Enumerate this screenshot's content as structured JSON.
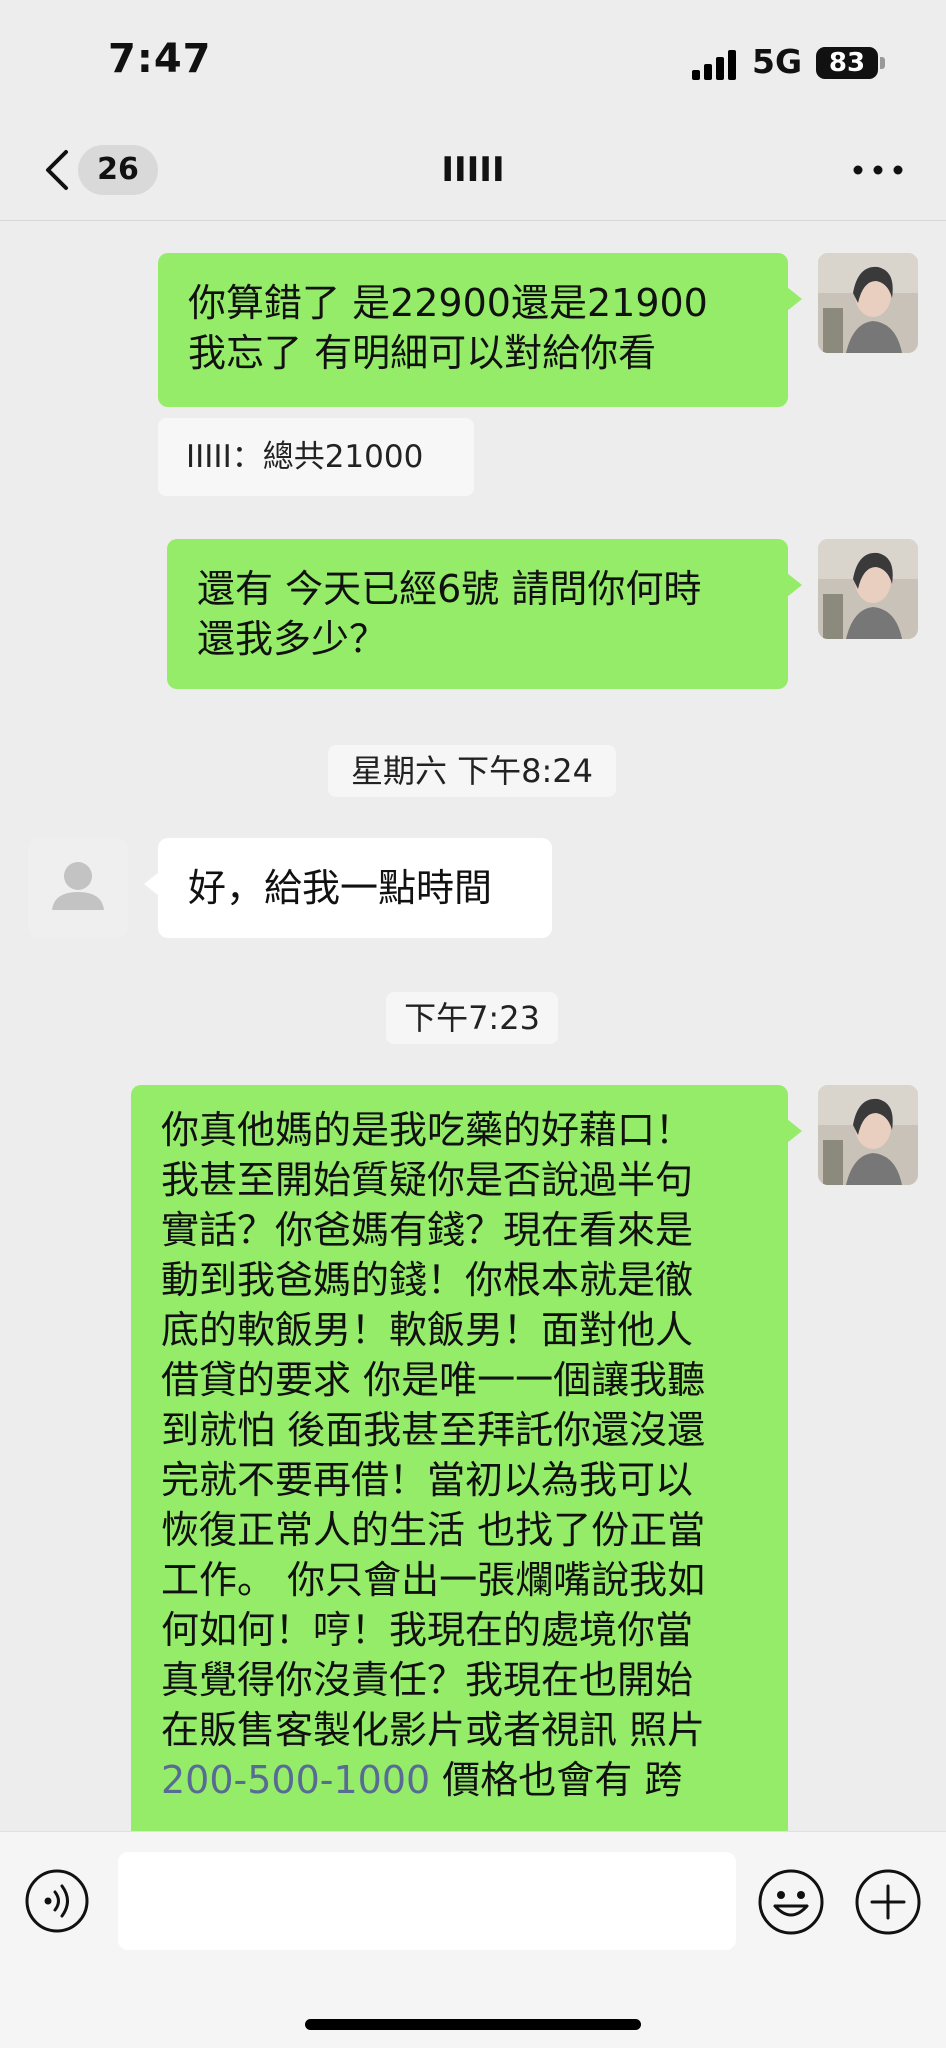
{
  "status_bar": {
    "time": "7:47",
    "network": "5G",
    "battery": "83"
  },
  "nav": {
    "unread_count": "26",
    "title": "IIIII"
  },
  "messages": {
    "m1": {
      "text": "你算錯了 是22900還是21900\n我忘了 有明細可以對給你看"
    },
    "quote": {
      "text": "IIIII：總共21000"
    },
    "m2": {
      "text": "還有 今天已經6號 請問你何時\n還我多少？"
    },
    "time1": {
      "text": "星期六 下午8:24"
    },
    "m3": {
      "text": "好，給我一點時間"
    },
    "time2": {
      "text": "下午7:23"
    },
    "m4": {
      "text_before": "你真他媽的是我吃藥的好藉口！\n我甚至開始質疑你是否說過半句\n實話？你爸媽有錢？現在看來是\n動到我爸媽的錢！你根本就是徹\n底的軟飯男！軟飯男！面對他人\n借貸的要求 你是唯一一個讓我聽\n到就怕 後面我甚至拜託你還沒還\n完就不要再借！當初以為我可以\n恢復正常人的生活 也找了份正當\n工作。 你只會出一張爛嘴說我如\n何如何！哼！我現在的處境你當\n真覺得你沒責任？我現在也開始\n在販售客製化影片或者視訊 照片\n",
      "phone": "200-500-1000",
      "text_after": " 價格也會有 跨"
    }
  },
  "input_bar": {
    "placeholder": ""
  },
  "colors": {
    "outgoing_bubble": "#95ec69",
    "incoming_bubble": "#ffffff",
    "background": "#ededed",
    "link": "#576b95"
  }
}
